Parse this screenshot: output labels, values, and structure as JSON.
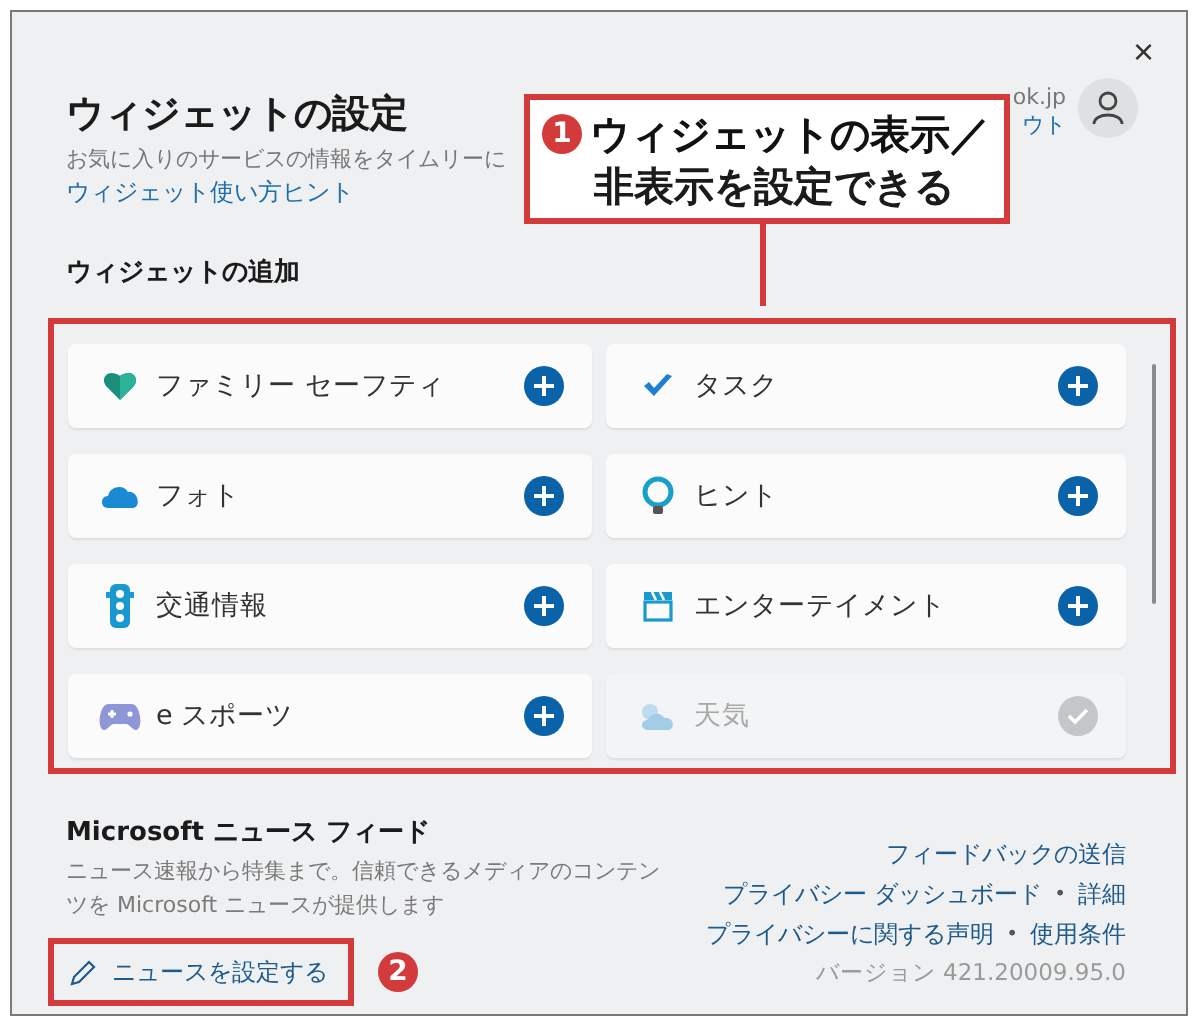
{
  "window": {
    "close": "×"
  },
  "header": {
    "title": "ウィジェットの設定",
    "subtitle": "お気に入りのサービスの情報をタイムリーに",
    "help_link": "ウィジェット使い方ヒント"
  },
  "account": {
    "email": "ok.jp",
    "sign_out": "ウト"
  },
  "callout": {
    "number": "1",
    "lines": [
      "ウィジェットの表示／",
      "非表示を設定できる"
    ]
  },
  "widgets_section": {
    "title": "ウィジェットの追加",
    "widgets": [
      {
        "name": "ファミリー セーフティ",
        "kind": "heart",
        "added": false
      },
      {
        "name": "タスク",
        "kind": "check",
        "added": false
      },
      {
        "name": "フォト",
        "kind": "cloud",
        "added": false
      },
      {
        "name": "ヒント",
        "kind": "bulb",
        "added": false
      },
      {
        "name": "交通情報",
        "kind": "traffic",
        "added": false
      },
      {
        "name": "エンターテイメント",
        "kind": "clapper",
        "added": false
      },
      {
        "name": "e スポーツ",
        "kind": "gamepad",
        "added": false
      },
      {
        "name": "天気",
        "kind": "weather",
        "added": true
      }
    ]
  },
  "news": {
    "title": "Microsoft ニュース フィード",
    "description": "ニュース速報から特集まで。信頼できるメディアのコンテンツを Microsoft ニュースが提供します",
    "button": "ニュースを設定する",
    "badge": "2",
    "link_rows": [
      [
        "フィードバックの送信"
      ],
      [
        "プライバシー ダッシュボード",
        "詳細"
      ],
      [
        "プライバシーに関する声明",
        "使用条件"
      ]
    ],
    "separator": "•",
    "version": "バージョン 421.20009.95.0"
  }
}
